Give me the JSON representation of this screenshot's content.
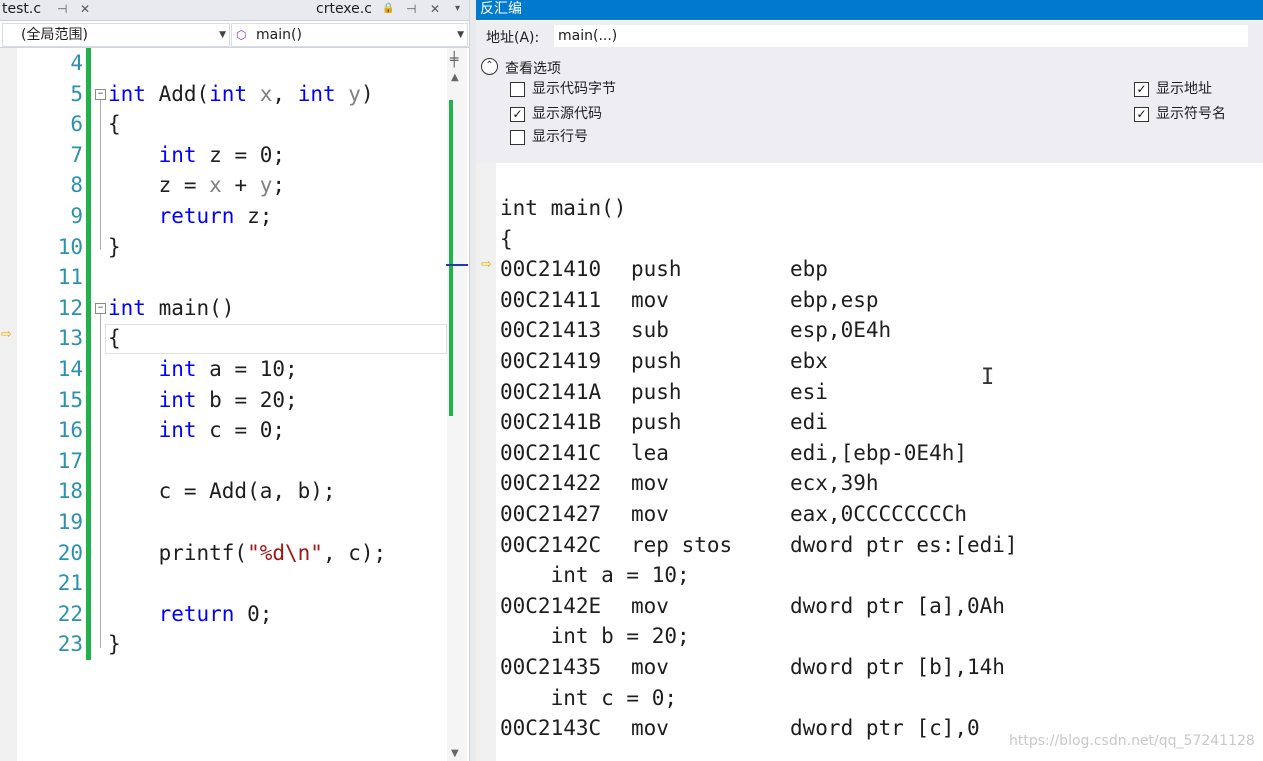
{
  "editor": {
    "tabs": [
      {
        "label": "test.c",
        "pin": "⊣",
        "close": "✕"
      },
      {
        "label": "crtexe.c",
        "lock": "🔒",
        "pin": "⊣",
        "close": "✕"
      }
    ],
    "tab_overflow": "▾",
    "scope_dropdown": "(全局范围)",
    "function_dropdown": "main()",
    "lines": [
      {
        "n": "4",
        "tokens": []
      },
      {
        "n": "5",
        "tokens": [
          [
            "kw",
            "int"
          ],
          [
            "t",
            " Add("
          ],
          [
            "kw",
            "int"
          ],
          [
            "t",
            " "
          ],
          [
            "p",
            "x"
          ],
          [
            "t",
            ", "
          ],
          [
            "kw",
            "int"
          ],
          [
            "t",
            " "
          ],
          [
            "p",
            "y"
          ],
          [
            "t",
            ")"
          ]
        ]
      },
      {
        "n": "6",
        "tokens": [
          [
            "t",
            "{"
          ]
        ]
      },
      {
        "n": "7",
        "tokens": [
          [
            "t",
            "    "
          ],
          [
            "kw",
            "int"
          ],
          [
            "t",
            " z = 0;"
          ]
        ]
      },
      {
        "n": "8",
        "tokens": [
          [
            "t",
            "    z = "
          ],
          [
            "p",
            "x"
          ],
          [
            "t",
            " + "
          ],
          [
            "p",
            "y"
          ],
          [
            "t",
            ";"
          ]
        ]
      },
      {
        "n": "9",
        "tokens": [
          [
            "t",
            "    "
          ],
          [
            "kw",
            "return"
          ],
          [
            "t",
            " z;"
          ]
        ]
      },
      {
        "n": "10",
        "tokens": [
          [
            "t",
            "}"
          ]
        ]
      },
      {
        "n": "11",
        "tokens": []
      },
      {
        "n": "12",
        "tokens": [
          [
            "kw",
            "int"
          ],
          [
            "t",
            " main()"
          ]
        ]
      },
      {
        "n": "13",
        "tokens": [
          [
            "t",
            "{"
          ]
        ]
      },
      {
        "n": "14",
        "tokens": [
          [
            "t",
            "    "
          ],
          [
            "kw",
            "int"
          ],
          [
            "t",
            " a = 10;"
          ]
        ]
      },
      {
        "n": "15",
        "tokens": [
          [
            "t",
            "    "
          ],
          [
            "kw",
            "int"
          ],
          [
            "t",
            " b = 20;"
          ]
        ]
      },
      {
        "n": "16",
        "tokens": [
          [
            "t",
            "    "
          ],
          [
            "kw",
            "int"
          ],
          [
            "t",
            " c = 0;"
          ]
        ]
      },
      {
        "n": "17",
        "tokens": []
      },
      {
        "n": "18",
        "tokens": [
          [
            "t",
            "    c = Add(a, b);"
          ]
        ]
      },
      {
        "n": "19",
        "tokens": []
      },
      {
        "n": "20",
        "tokens": [
          [
            "t",
            "    printf("
          ],
          [
            "s",
            "\"%d\\n\""
          ],
          [
            "t",
            ", c);"
          ]
        ]
      },
      {
        "n": "21",
        "tokens": []
      },
      {
        "n": "22",
        "tokens": [
          [
            "t",
            "    "
          ],
          [
            "kw",
            "return"
          ],
          [
            "t",
            " 0;"
          ]
        ]
      },
      {
        "n": "23",
        "tokens": [
          [
            "t",
            "}"
          ]
        ]
      }
    ]
  },
  "disassembly": {
    "title": "反汇编",
    "address_label": "地址(A):",
    "address_value": "main(...)",
    "options_title": "查看选项",
    "options": [
      {
        "label": "显示代码字节",
        "checked": false
      },
      {
        "label": "显示源代码",
        "checked": true
      },
      {
        "label": "显示行号",
        "checked": false
      },
      {
        "label": "显示地址",
        "checked": true
      },
      {
        "label": "显示符号名",
        "checked": true
      }
    ],
    "check_mark": "✓",
    "lines": [
      {
        "kind": "src",
        "text": "int main()"
      },
      {
        "kind": "src",
        "text": "{"
      },
      {
        "kind": "asm",
        "addr": "00C21410",
        "op": "push",
        "args": "ebp"
      },
      {
        "kind": "asm",
        "addr": "00C21411",
        "op": "mov",
        "args": "ebp,esp"
      },
      {
        "kind": "asm",
        "addr": "00C21413",
        "op": "sub",
        "args": "esp,0E4h"
      },
      {
        "kind": "asm",
        "addr": "00C21419",
        "op": "push",
        "args": "ebx"
      },
      {
        "kind": "asm",
        "addr": "00C2141A",
        "op": "push",
        "args": "esi"
      },
      {
        "kind": "asm",
        "addr": "00C2141B",
        "op": "push",
        "args": "edi"
      },
      {
        "kind": "asm",
        "addr": "00C2141C",
        "op": "lea",
        "args": "edi,[ebp-0E4h]"
      },
      {
        "kind": "asm",
        "addr": "00C21422",
        "op": "mov",
        "args": "ecx,39h"
      },
      {
        "kind": "asm",
        "addr": "00C21427",
        "op": "mov",
        "args": "eax,0CCCCCCCCh"
      },
      {
        "kind": "asm",
        "addr": "00C2142C",
        "op": "rep stos",
        "args": "dword ptr es:[edi]"
      },
      {
        "kind": "src",
        "text": "    int a = 10;"
      },
      {
        "kind": "asm",
        "addr": "00C2142E",
        "op": "mov",
        "args": "dword ptr [a],0Ah"
      },
      {
        "kind": "src",
        "text": "    int b = 20;"
      },
      {
        "kind": "asm",
        "addr": "00C21435",
        "op": "mov",
        "args": "dword ptr [b],14h"
      },
      {
        "kind": "src",
        "text": "    int c = 0;"
      },
      {
        "kind": "asm",
        "addr": "00C2143C",
        "op": "mov",
        "args": "dword ptr [c],0"
      }
    ]
  },
  "icons": {
    "ip_arrow": "⇨",
    "toggle": "⌃",
    "fold_minus": "−",
    "scroll_up": "▲",
    "scroll_down": "▼",
    "split": "╪",
    "text_cursor": "I",
    "function_icon": "⬡"
  },
  "colors": {
    "keyword": "#0000ff",
    "param": "#808080",
    "string": "#a31515",
    "line_number": "#2b91af",
    "change_bar": "#22b14c",
    "title_bar": "#007acc"
  },
  "watermark": "https://blog.csdn.net/qq_57241128"
}
